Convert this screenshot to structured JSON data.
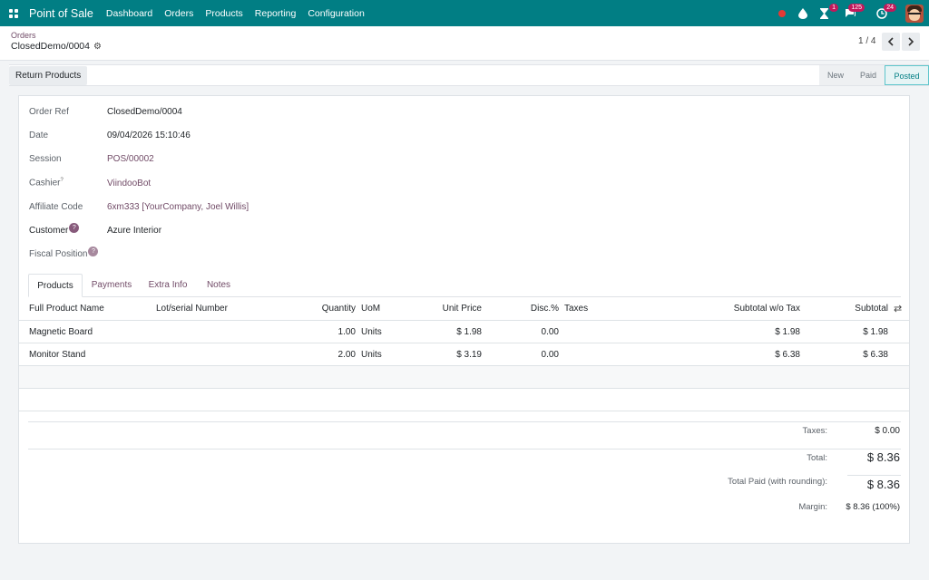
{
  "topbar": {
    "app_name": "Point of Sale",
    "menu": [
      "Dashboard",
      "Orders",
      "Products",
      "Reporting",
      "Configuration"
    ],
    "activity_badge": "1",
    "messages_badge": "125",
    "clock_badge": "24"
  },
  "breadcrumb": {
    "parent": "Orders",
    "current": "ClosedDemo/0004"
  },
  "pager": {
    "value": "1 / 4"
  },
  "actions": {
    "return_products": "Return Products"
  },
  "status": {
    "steps": [
      "New",
      "Paid",
      "Posted"
    ],
    "active": "Posted"
  },
  "fields": {
    "order_ref_label": "Order Ref",
    "order_ref": "ClosedDemo/0004",
    "date_label": "Date",
    "date": "09/04/2026 15:10:46",
    "session_label": "Session",
    "session": "POS/00002",
    "cashier_label": "Cashier",
    "cashier": "ViindooBot",
    "affiliate_label": "Affiliate Code",
    "affiliate": "6xm333 [YourCompany, Joel Willis]",
    "customer_label": "Customer",
    "customer": "Azure Interior",
    "fiscal_label": "Fiscal Position",
    "help_mark": "?"
  },
  "tabs": [
    "Products",
    "Payments",
    "Extra Info",
    "Notes"
  ],
  "table": {
    "headers": {
      "product": "Full Product Name",
      "lot": "Lot/serial Number",
      "qty": "Quantity",
      "uom": "UoM",
      "price": "Unit Price",
      "disc": "Disc.%",
      "taxes": "Taxes",
      "subtotal_wo": "Subtotal w/o Tax",
      "subtotal": "Subtotal"
    },
    "rows": [
      {
        "product": "Magnetic Board",
        "qty": "1.00",
        "uom": "Units",
        "price": "$ 1.98",
        "disc": "0.00",
        "subtotal_wo": "$ 1.98",
        "subtotal": "$ 1.98"
      },
      {
        "product": "Monitor Stand",
        "qty": "2.00",
        "uom": "Units",
        "price": "$ 3.19",
        "disc": "0.00",
        "subtotal_wo": "$ 6.38",
        "subtotal": "$ 6.38"
      }
    ]
  },
  "totals": {
    "taxes_label": "Taxes:",
    "taxes": "$ 0.00",
    "total_label": "Total:",
    "total": "$ 8.36",
    "paid_label": "Total Paid (with rounding):",
    "paid": "$ 8.36",
    "margin_label": "Margin:",
    "margin": "$ 8.36 (100%)"
  }
}
